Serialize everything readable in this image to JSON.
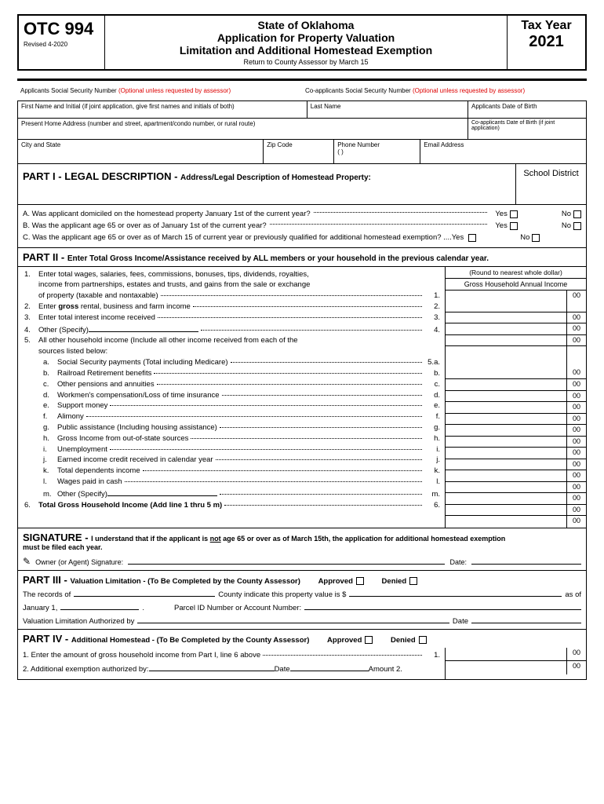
{
  "header": {
    "form_code": "OTC 994",
    "revised": "Revised 4-2020",
    "state": "State of Oklahoma",
    "title1": "Application for Property Valuation",
    "title2": "Limitation and Additional Homestead Exemption",
    "return_by": "Return to County Assessor by March 15",
    "tax_year_label": "Tax Year",
    "tax_year": "2021"
  },
  "ssn": {
    "app_label": "Applicants Social Security Number ",
    "coapp_label": "Co-applicants Social Security Number ",
    "optional": "(Optional unless requested by assessor)"
  },
  "fields": {
    "first_name": "First Name and Initial (if joint application, give first names and initials of both)",
    "last_name": "Last Name",
    "app_dob": "Applicants Date of Birth",
    "address": "Present Home Address (number and street, apartment/condo number, or rural route)",
    "coapp_dob": "Co-applicants Date of Birth (if joint application)",
    "city_state": "City and State",
    "zip": "Zip Code",
    "phone": "Phone Number",
    "phone_paren": "(          )",
    "email": "Email Address"
  },
  "part1": {
    "title": "PART I - LEGAL DESCRIPTION - ",
    "desc": "Address/Legal Description of Homestead Property:",
    "school": "School District",
    "qA": "A. Was applicant domiciled on the homestead property January 1st of the current year?",
    "qB": "B. Was the applicant age 65 or over as of January 1st of the current year?",
    "qC": "C. Was the applicant age 65 or over as of March 15 of current year or previously qualified for additional homestead exemption? ....Yes",
    "yes": "Yes",
    "no": "No"
  },
  "part2": {
    "title": "PART II - ",
    "desc": "Enter Total Gross Income/Assistance received by ALL members or your household in the previous calendar year.",
    "round": "(Round to nearest whole dollar)",
    "col_hdr": "Gross Household Annual Income",
    "cents": "00",
    "l1a": "Enter total wages, salaries, fees, commissions, bonuses, tips, dividends, royalties,",
    "l1b": "income from partnerships, estates and trusts, and gains from the sale or exchange",
    "l1c": "of property (taxable and nontaxable)",
    "l2": "Enter gross rental, business and farm income",
    "l3": "Enter total interest income received",
    "l4": "Other (Specify)",
    "l5": "All other household income (Include all other income received from each of the",
    "l5b": "sources listed below:",
    "sa": "Social Security payments (Total including Medicare)",
    "sb": "Railroad Retirement benefits",
    "sc": "Other pensions and annuities",
    "sd": "Workmen's compensation/Loss of time insurance",
    "se": "Support money",
    "sf": "Alimony",
    "sg": "Public assistance (Including housing assistance)",
    "sh": "Gross Income from out-of-state sources",
    "si": "Unemployment",
    "sj": "Earned income credit received in calendar year",
    "sk": "Total dependents income",
    "sl": "Wages paid in cash",
    "sm": "Other (Specify)",
    "l6": "Total Gross Household Income (Add line 1 thru 5 m)",
    "n1": "1.",
    "n2": "2.",
    "n3": "3.",
    "n4": "4.",
    "n5": "5.",
    "n6": "6.",
    "na": "a.",
    "nb": "b.",
    "nc": "c.",
    "nd": "d.",
    "ne": "e.",
    "nf": "f.",
    "ng": "g.",
    "nh": "h.",
    "ni": "i.",
    "nj": "j.",
    "nk": "k.",
    "nl": "l.",
    "nm": "m.",
    "e5a": "5.a.",
    "e5b": "b.",
    "e5c": "c.",
    "e5d": "d.",
    "e5e": "e.",
    "e5f": "f.",
    "e5g": "g.",
    "e5h": "h.",
    "e5i": "i.",
    "e5j": "j.",
    "e5k": "k.",
    "e5l": "l.",
    "e5m": "m."
  },
  "sig": {
    "title": "SIGNATURE - ",
    "text1": "I understand that if the applicant is ",
    "not": "not",
    "text2": " age 65 or over as of March 15th, the application for additional homestead exemption",
    "text3": "must be filed each year.",
    "owner": "Owner (or Agent) Signature:",
    "date": "Date:"
  },
  "part3": {
    "title": "PART III - ",
    "desc": "Valuation Limitation - (To Be Completed by the County Assessor)",
    "approved": "Approved",
    "denied": "Denied",
    "rec1": "The records of",
    "rec2": "County indicate this property value is $",
    "asof": "as of",
    "jan": "January 1,",
    "parcel": "Parcel ID Number or Account Number:",
    "auth": "Valuation Limitation Authorized by",
    "date": "Date"
  },
  "part4": {
    "title": "PART IV - ",
    "desc": "Additional Homestead - (To Be Completed by the County Assessor)",
    "l1": "1. Enter the amount of gross household income from Part I, line 6 above",
    "l2": "2. Additional exemption authorized by:",
    "date": "Date",
    "amt": "Amount  2.",
    "n1": "1."
  }
}
